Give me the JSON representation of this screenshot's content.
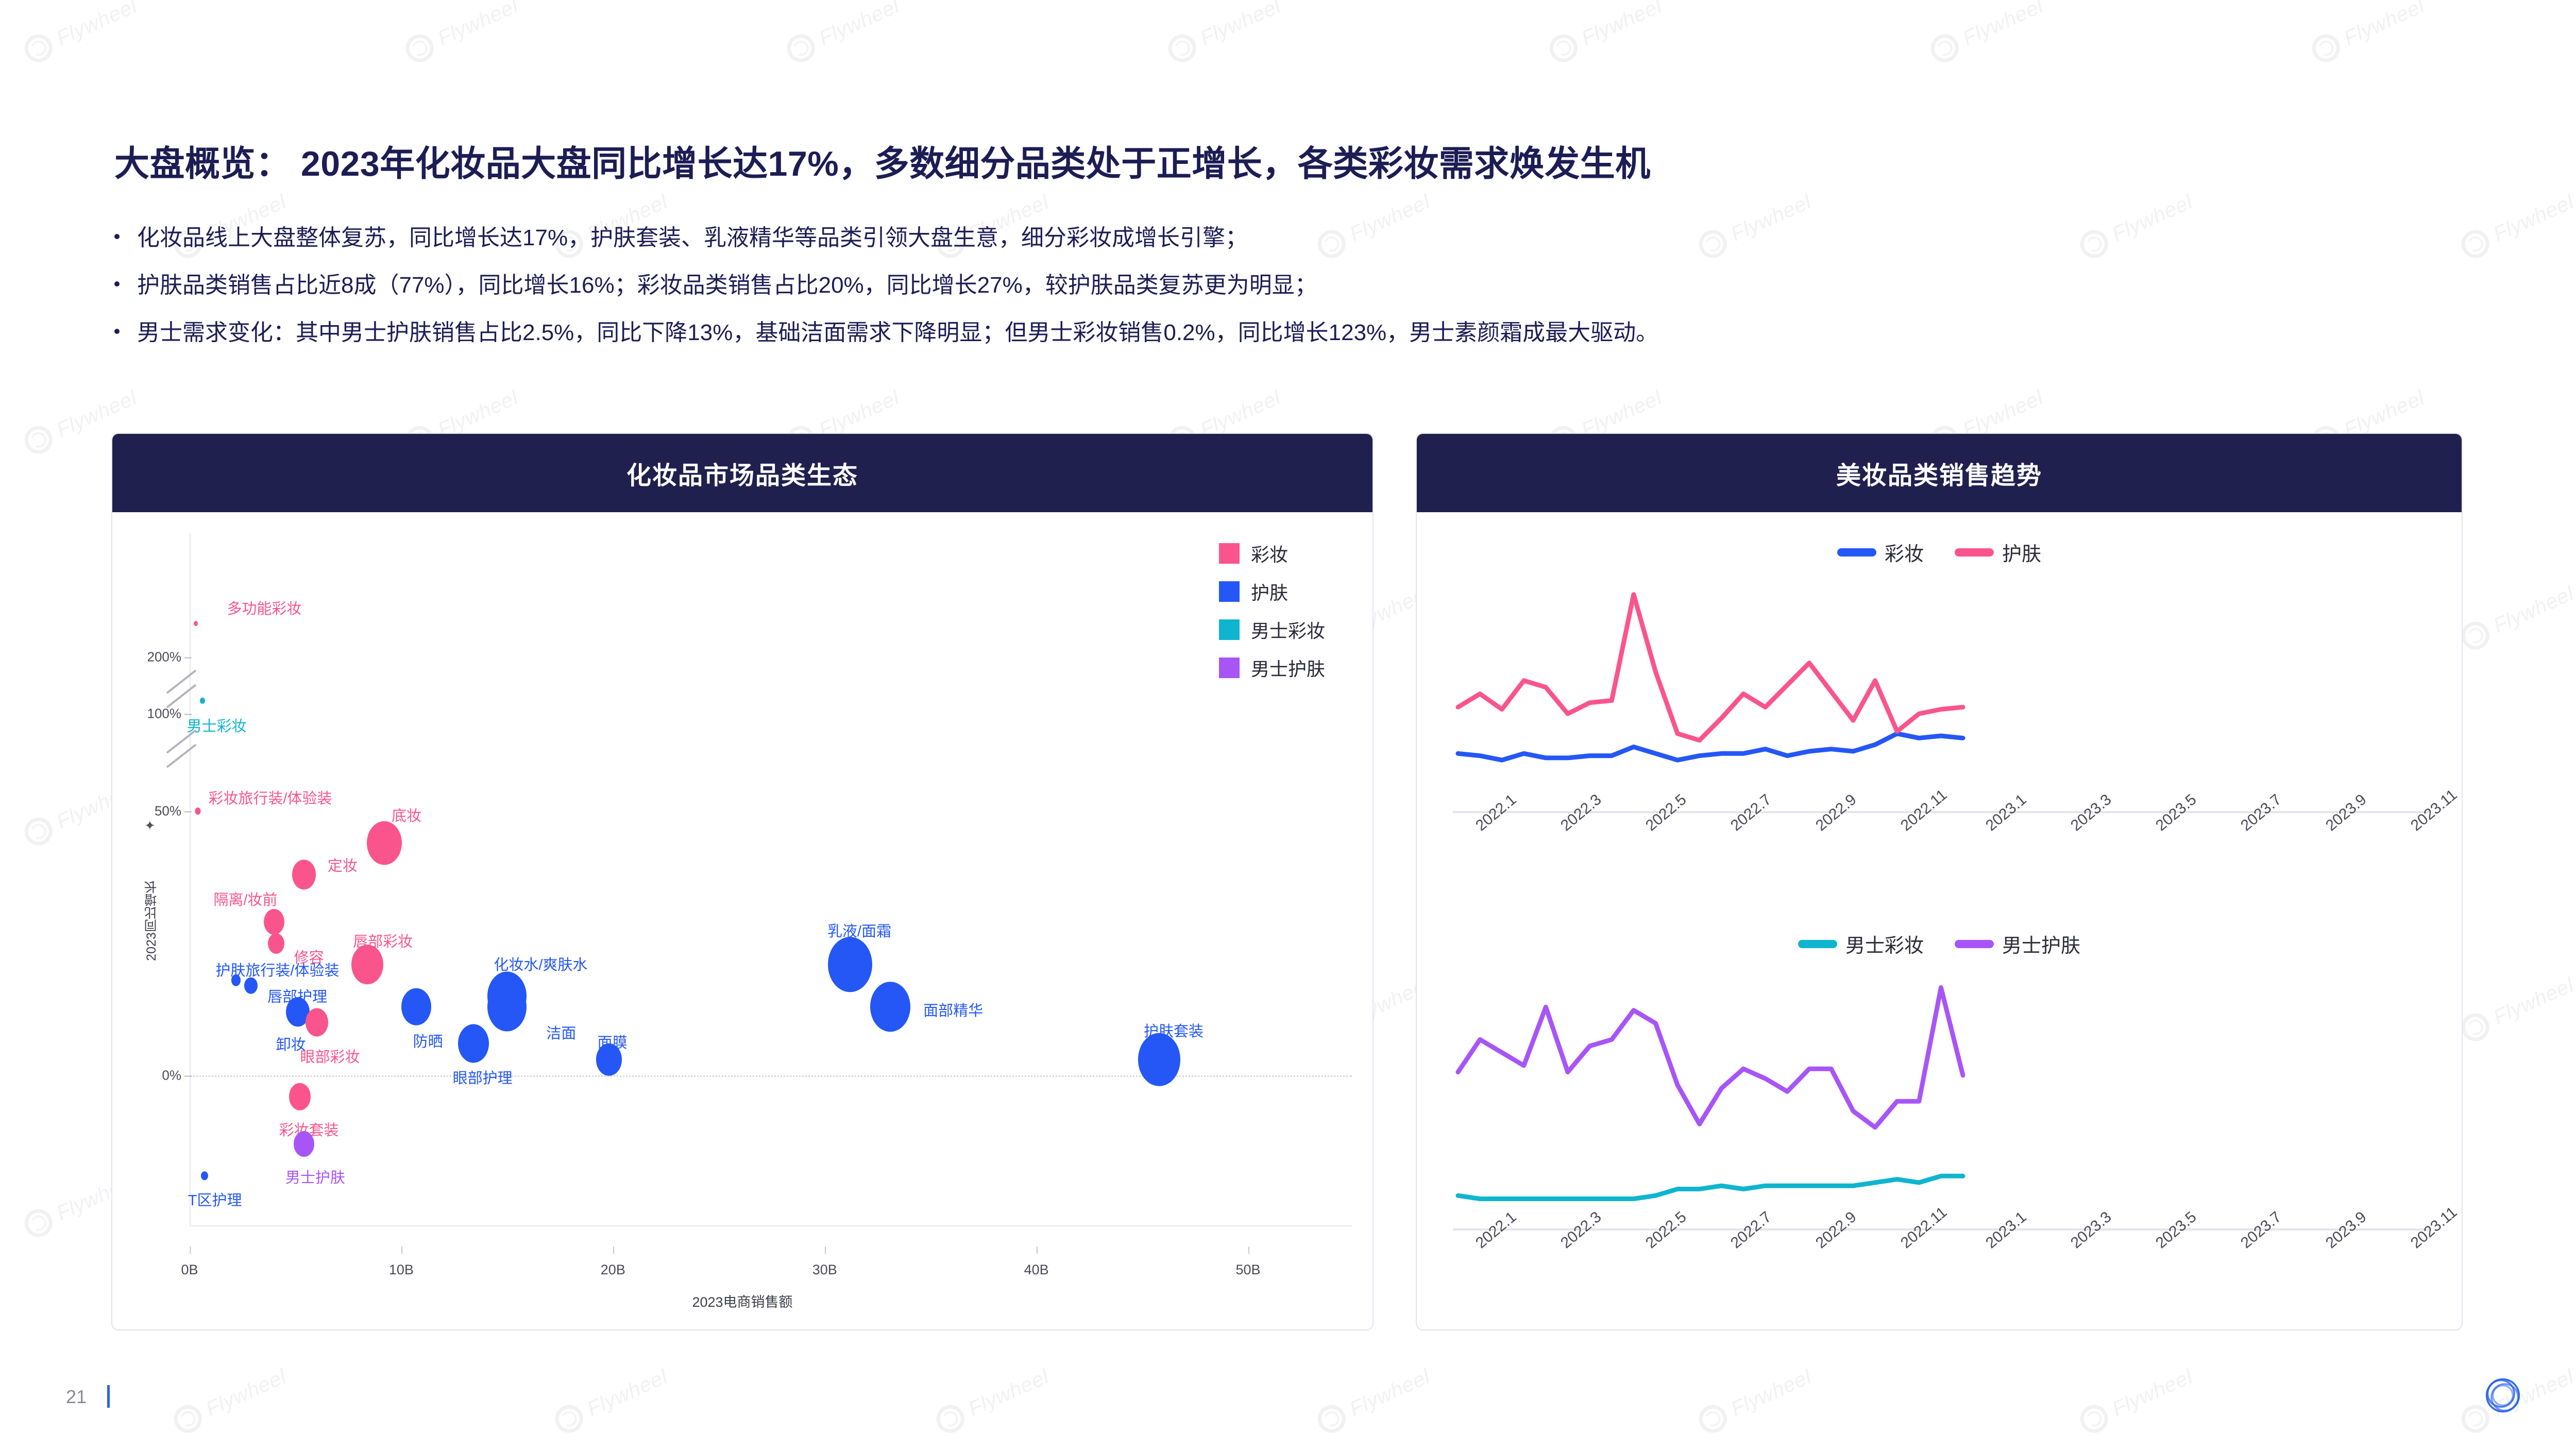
{
  "slide": {
    "title": "大盘概览： 2023年化妆品大盘同比增长达17%，多数细分品类处于正增长，各类彩妆需求焕发生机",
    "bullets": [
      "化妆品线上大盘整体复苏，同比增长达17%，护肤套装、乳液精华等品类引领大盘生意，细分彩妆成增长引擎；",
      "护肤品类销售占比近8成（77%），同比增长16%；彩妆品类销售占比20%，同比增长27%，较护肤品类复苏更为明显；",
      "男士需求变化：其中男士护肤销售占比2.5%，同比下降13%，基础洁面需求下降明显；但男士彩妆销售0.2%，同比增长123%，男士素颜霜成最大驱动。"
    ],
    "page_number": "21",
    "watermark_text": "Flywheel"
  },
  "colors": {
    "header_navy": "#20204f",
    "title_navy": "#1d1d55",
    "pink": "#f9558c",
    "blue": "#2457f5",
    "cyan": "#0fb5ce",
    "purple": "#a855f7",
    "accent_blue": "#2a62e8"
  },
  "panels": {
    "left": {
      "title": "化妆品市场品类生态"
    },
    "right": {
      "title": "美妆品类销售趋势"
    }
  },
  "chart_data": [
    {
      "type": "scatter",
      "title": "化妆品市场品类生态",
      "xlabel": "2023电商销售额",
      "ylabel": "2023同比增长",
      "xticks": [
        "0B",
        "10B",
        "20B",
        "30B",
        "40B",
        "50B"
      ],
      "yticks": [
        "200%",
        "100%",
        "50%",
        "0%"
      ],
      "xlim": [
        0,
        55
      ],
      "broken_axis": true,
      "legend_position": "top-right",
      "legend": [
        {
          "label": "彩妆",
          "color": "#f9558c"
        },
        {
          "label": "护肤",
          "color": "#2457f5"
        },
        {
          "label": "男士彩妆",
          "color": "#0fb5ce"
        },
        {
          "label": "男士护肤",
          "color": "#a855f7"
        }
      ],
      "points": [
        {
          "label": "多功能彩妆",
          "series": "彩妆",
          "x": 0.3,
          "y": 260,
          "size": 8,
          "lx": 60,
          "ly": -52
        },
        {
          "label": "男士彩妆",
          "series": "男士彩妆",
          "x": 0.6,
          "y": 123,
          "size": 10,
          "lx": -30,
          "ly": 26
        },
        {
          "label": "彩妆旅行装/体验装",
          "series": "彩妆",
          "x": 0.4,
          "y": 50,
          "size": 11,
          "lx": 20,
          "ly": -48
        },
        {
          "label": "底妆",
          "series": "彩妆",
          "x": 9.2,
          "y": 44,
          "size": 68,
          "lx": 14,
          "ly": -76
        },
        {
          "label": "定妆",
          "series": "彩妆",
          "x": 5.4,
          "y": 38,
          "size": 46,
          "lx": 46,
          "ly": -40
        },
        {
          "label": "隔离/妆前",
          "series": "彩妆",
          "x": 4.0,
          "y": 29,
          "size": 40,
          "lx": -118,
          "ly": -66
        },
        {
          "label": "修容",
          "series": "彩妆",
          "x": 4.1,
          "y": 25,
          "size": 32,
          "lx": 34,
          "ly": 4
        },
        {
          "label": "唇部彩妆",
          "series": "彩妆",
          "x": 8.4,
          "y": 21,
          "size": 62,
          "lx": -28,
          "ly": -68
        },
        {
          "label": "护肤旅行装/体验装",
          "series": "护肤",
          "x": 2.2,
          "y": 18,
          "size": 18,
          "lx": -40,
          "ly": -42
        },
        {
          "label": "唇部护理",
          "series": "护肤",
          "x": 2.9,
          "y": 17,
          "size": 26,
          "lx": 32,
          "ly": -2
        },
        {
          "label": "化妆水/爽肤水",
          "series": "护肤",
          "x": 15.0,
          "y": 15,
          "size": 76,
          "lx": -26,
          "ly": -84
        },
        {
          "label": "洁面",
          "series": "护肤",
          "x": 15.0,
          "y": 13,
          "size": 76,
          "lx": 76,
          "ly": 28
        },
        {
          "label": "卸妆",
          "series": "护肤",
          "x": 5.1,
          "y": 12,
          "size": 46,
          "lx": -42,
          "ly": 40
        },
        {
          "label": "眼部彩妆",
          "series": "彩妆",
          "x": 6.0,
          "y": 10,
          "size": 44,
          "lx": -32,
          "ly": 44
        },
        {
          "label": "防晒",
          "series": "护肤",
          "x": 10.7,
          "y": 13,
          "size": 58,
          "lx": -6,
          "ly": 44
        },
        {
          "label": "眼部护理",
          "series": "护肤",
          "x": 13.4,
          "y": 6,
          "size": 60,
          "lx": -40,
          "ly": 44
        },
        {
          "label": "乳液/面霜",
          "series": "护肤",
          "x": 31.2,
          "y": 21,
          "size": 86,
          "lx": -44,
          "ly": -88
        },
        {
          "label": "面部精华",
          "series": "护肤",
          "x": 33.1,
          "y": 13,
          "size": 78,
          "lx": 64,
          "ly": -16
        },
        {
          "label": "面膜",
          "series": "护肤",
          "x": 19.8,
          "y": 3,
          "size": 50,
          "lx": -22,
          "ly": -56
        },
        {
          "label": "护肤套装",
          "series": "护肤",
          "x": 45.8,
          "y": 3,
          "size": 82,
          "lx": -30,
          "ly": -78
        },
        {
          "label": "彩妆套装",
          "series": "彩妆",
          "x": 5.2,
          "y": -4,
          "size": 42,
          "lx": -40,
          "ly": 42
        },
        {
          "label": "男士护肤",
          "series": "男士护肤",
          "x": 5.4,
          "y": -13,
          "size": 40,
          "lx": -36,
          "ly": 42
        },
        {
          "label": "T区护理",
          "series": "护肤",
          "x": 0.7,
          "y": -19,
          "size": 14,
          "lx": -32,
          "ly": 24
        }
      ]
    },
    {
      "type": "line",
      "title": "美妆品类销售趋势 - 彩妆/护肤",
      "x": [
        "2022.1",
        "2022.2",
        "2022.3",
        "2022.4",
        "2022.5",
        "2022.6",
        "2022.7",
        "2022.8",
        "2022.9",
        "2022.10",
        "2022.11",
        "2022.12",
        "2023.1",
        "2023.2",
        "2023.3",
        "2023.4",
        "2023.5",
        "2023.6",
        "2023.7",
        "2023.8",
        "2023.9",
        "2023.10",
        "2023.11",
        "2023.12"
      ],
      "xticks": [
        "2022.1",
        "2022.3",
        "2022.5",
        "2022.7",
        "2022.9",
        "2022.11",
        "2023.1",
        "2023.3",
        "2023.5",
        "2023.7",
        "2023.9",
        "2023.11"
      ],
      "legend_position": "top-center",
      "series": [
        {
          "name": "彩妆",
          "color": "#2457f5",
          "values": [
            20,
            19,
            17,
            20,
            18,
            18,
            19,
            19,
            23,
            20,
            17,
            19,
            20,
            20,
            22,
            19,
            21,
            22,
            21,
            24,
            29,
            27,
            28,
            27
          ]
        },
        {
          "name": "护肤",
          "color": "#f9558c",
          "values": [
            41,
            47,
            40,
            53,
            50,
            38,
            43,
            44,
            92,
            57,
            29,
            26,
            36,
            47,
            41,
            51,
            61,
            48,
            35,
            53,
            30,
            38,
            40,
            41
          ]
        }
      ]
    },
    {
      "type": "line",
      "title": "美妆品类销售趋势 - 男士彩妆/男士护肤",
      "x": [
        "2022.1",
        "2022.2",
        "2022.3",
        "2022.4",
        "2022.5",
        "2022.6",
        "2022.7",
        "2022.8",
        "2022.9",
        "2022.10",
        "2022.11",
        "2022.12",
        "2023.1",
        "2023.2",
        "2023.3",
        "2023.4",
        "2023.5",
        "2023.6",
        "2023.7",
        "2023.8",
        "2023.9",
        "2023.10",
        "2023.11",
        "2023.12"
      ],
      "xticks": [
        "2022.1",
        "2022.3",
        "2022.5",
        "2022.7",
        "2022.9",
        "2022.11",
        "2023.1",
        "2023.3",
        "2023.5",
        "2023.7",
        "2023.9",
        "2023.11"
      ],
      "legend_position": "top-center",
      "series": [
        {
          "name": "男士彩妆",
          "color": "#0fb5ce",
          "values": [
            6,
            5,
            5,
            5,
            5,
            5,
            5,
            5,
            5,
            6,
            8,
            8,
            9,
            8,
            9,
            9,
            9,
            9,
            9,
            10,
            11,
            10,
            12,
            12
          ]
        },
        {
          "name": "男士护肤",
          "color": "#a855f7",
          "values": [
            44,
            54,
            50,
            46,
            64,
            44,
            52,
            54,
            63,
            59,
            40,
            28,
            39,
            45,
            42,
            38,
            45,
            45,
            32,
            27,
            35,
            35,
            70,
            43
          ]
        }
      ]
    }
  ]
}
